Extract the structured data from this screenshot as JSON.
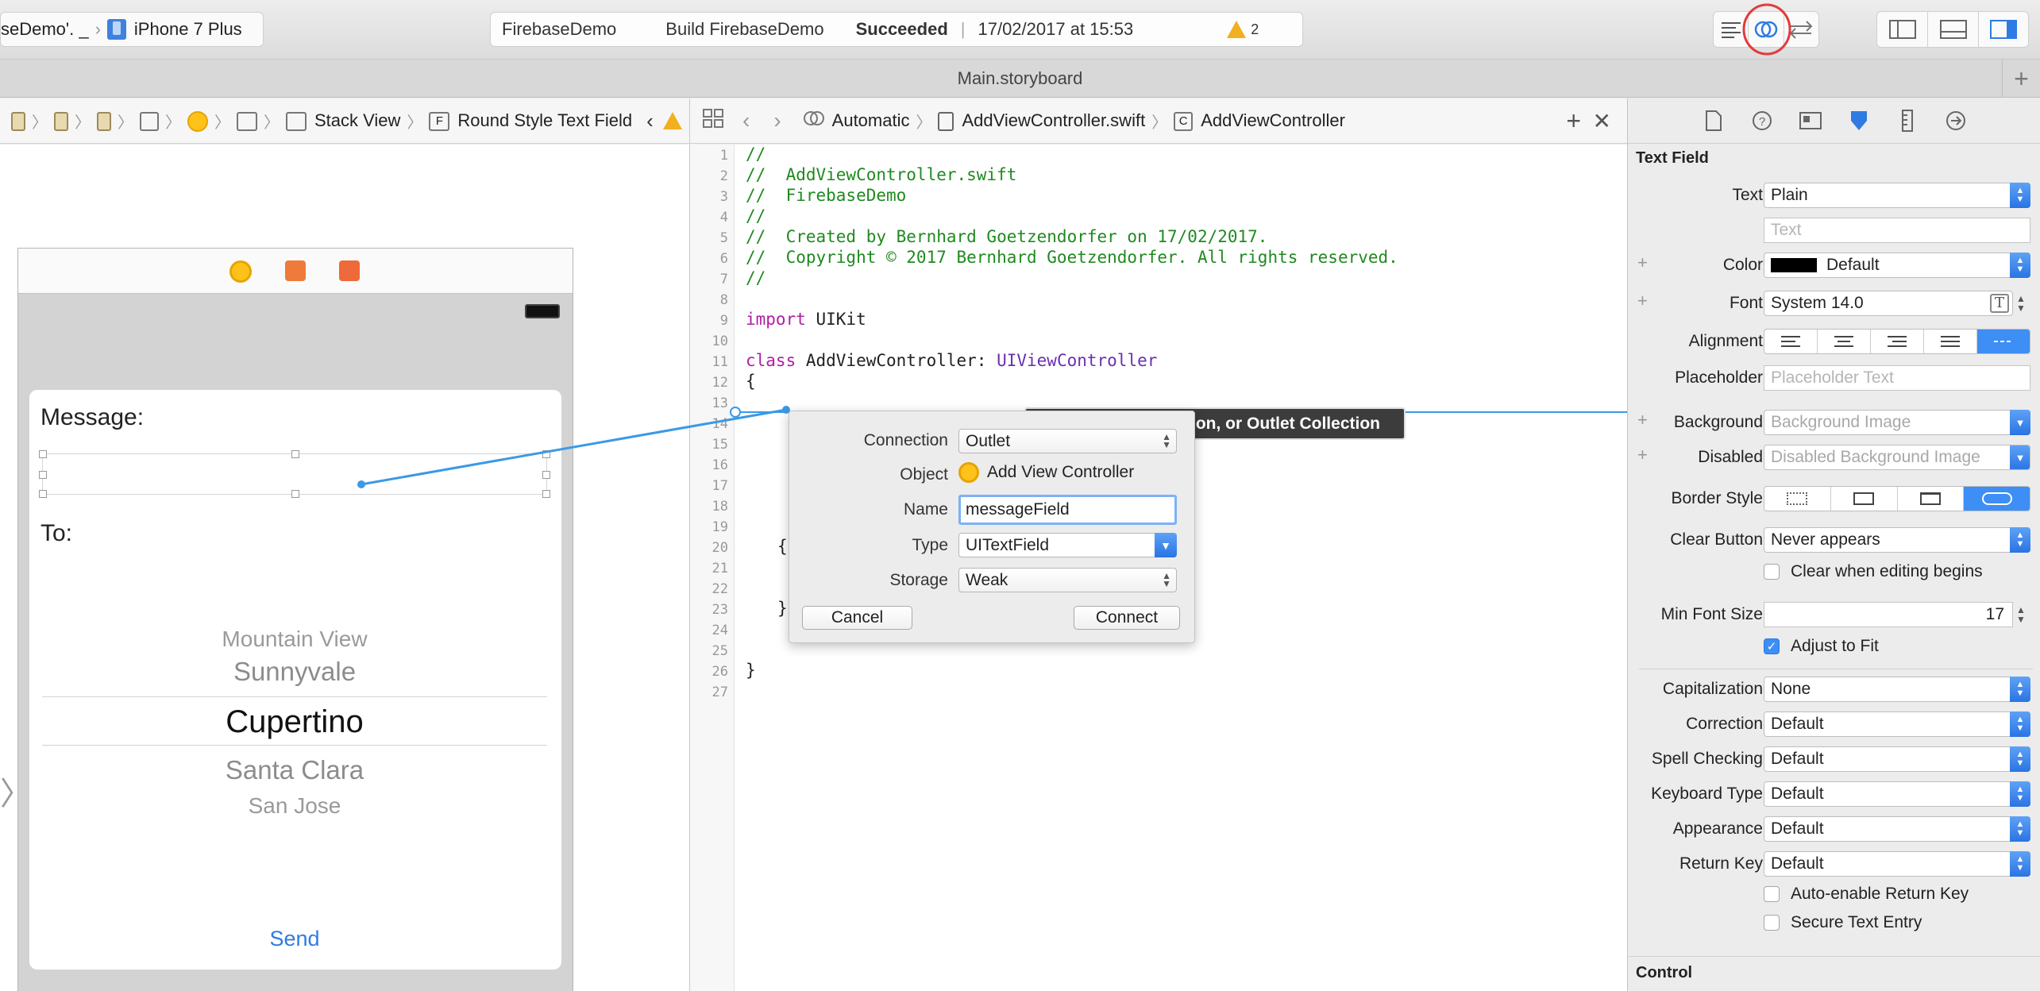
{
  "toolbar": {
    "scheme": "seDemo'. _",
    "device": "iPhone 7 Plus",
    "status": {
      "project": "FirebaseDemo",
      "action": "Build FirebaseDemo",
      "result": "Succeeded",
      "separator": "|",
      "timestamp": "17/02/2017 at 15:53",
      "warning_count": "2"
    }
  },
  "tab": {
    "title": "Main.storyboard"
  },
  "canvas_jumpbar": {
    "items": [
      "Stack View",
      "Round Style Text Field"
    ],
    "text_field_glyph": "F"
  },
  "editor_jumpbar": {
    "mode": "Automatic",
    "file": "AddViewController.swift",
    "symbol": "AddViewController",
    "symbol_glyph": "C"
  },
  "scene": {
    "message_label": "Message:",
    "to_label": "To:",
    "picker_items": [
      "Mountain View",
      "Sunnyvale",
      "Cupertino",
      "Santa Clara",
      "San Jose"
    ],
    "send_button": "Send"
  },
  "code": {
    "line_numbers": [
      "1",
      "2",
      "3",
      "4",
      "5",
      "6",
      "7",
      "8",
      "9",
      "10",
      "11",
      "12",
      "13",
      "14",
      "15",
      "16",
      "17",
      "18",
      "19",
      "20",
      "21",
      "22",
      "23",
      "24",
      "25",
      "26",
      "27"
    ],
    "lines": {
      "l1": "//",
      "l2": "//  AddViewController.swift",
      "l3": "//  FirebaseDemo",
      "l4": "//",
      "l5": "//  Created by Bernhard Goetzendorfer on 17/02/2017.",
      "l6": "//  Copyright © 2017 Bernhard Goetzendorfer. All rights reserved.",
      "l7": "//",
      "l9_kw": "import",
      "l9_rest": " UIKit",
      "l11_kw": "class",
      "l11_name": " AddViewController: ",
      "l11_type": "UIViewController",
      "l12": "{",
      "l20": "{",
      "l23": "}",
      "l26": "}"
    }
  },
  "tooltip": "on, or Outlet Collection",
  "popover": {
    "connection_label": "Connection",
    "connection_value": "Outlet",
    "object_label": "Object",
    "object_value": "Add View Controller",
    "name_label": "Name",
    "name_value": "messageField",
    "type_label": "Type",
    "type_value": "UITextField",
    "storage_label": "Storage",
    "storage_value": "Weak",
    "cancel": "Cancel",
    "connect": "Connect"
  },
  "inspector": {
    "section": "Text Field",
    "text_label": "Text",
    "text_value": "Plain",
    "text_placeholder": "Text",
    "color_label": "Color",
    "color_value": "Default",
    "font_label": "Font",
    "font_value": "System 14.0",
    "alignment_label": "Alignment",
    "placeholder_label": "Placeholder",
    "placeholder_placeholder": "Placeholder Text",
    "background_label": "Background",
    "background_placeholder": "Background Image",
    "disabled_label": "Disabled",
    "disabled_placeholder": "Disabled Background Image",
    "border_style_label": "Border Style",
    "clear_button_label": "Clear Button",
    "clear_button_value": "Never appears",
    "clear_when_editing": "Clear when editing begins",
    "min_font_label": "Min Font Size",
    "min_font_value": "17",
    "adjust_to_fit": "Adjust to Fit",
    "capitalization_label": "Capitalization",
    "capitalization_value": "None",
    "correction_label": "Correction",
    "correction_value": "Default",
    "spell_label": "Spell Checking",
    "spell_value": "Default",
    "keyboard_label": "Keyboard Type",
    "keyboard_value": "Default",
    "appearance_label": "Appearance",
    "appearance_value": "Default",
    "return_label": "Return Key",
    "return_value": "Default",
    "auto_enable": "Auto-enable Return Key",
    "secure": "Secure Text Entry",
    "control_section": "Control"
  },
  "colors": {
    "accent": "#3d8ef5",
    "warning": "#f2b01e",
    "comment": "#1f8a1f",
    "keyword": "#b01ea6",
    "highlight_circle": "#e23b3b",
    "connection_line": "#3b99e6"
  }
}
